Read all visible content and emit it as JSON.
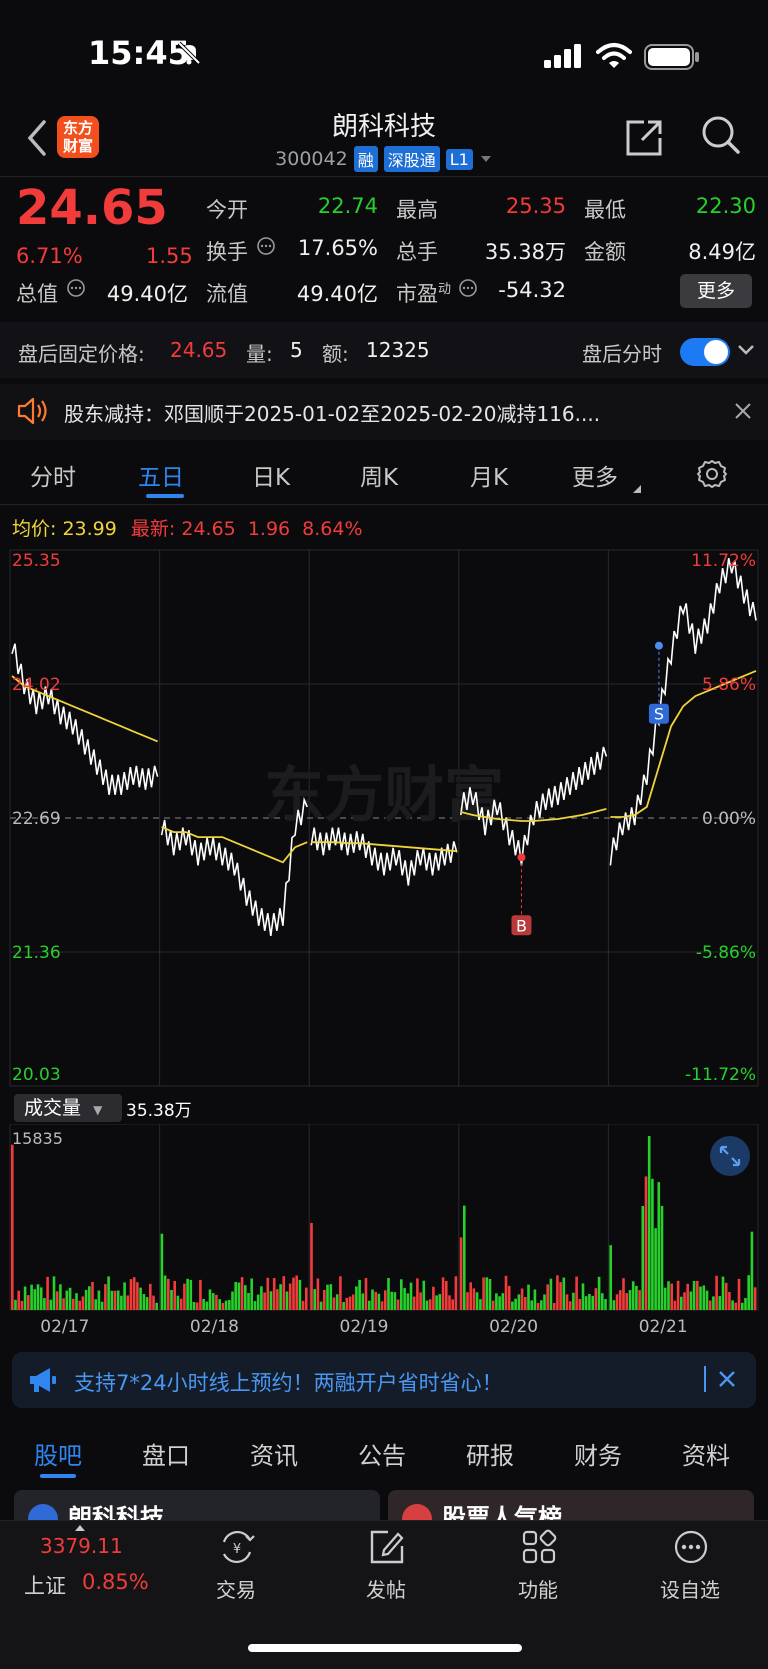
{
  "status": {
    "time": "15:45"
  },
  "header": {
    "back": "‹",
    "logo_line1": "东方",
    "logo_line2": "财富",
    "name": "朗科科技",
    "code": "300042",
    "tags": [
      "融",
      "深股通",
      "L1"
    ]
  },
  "quote": {
    "price": "24.65",
    "pct": "6.71%",
    "chg": "1.55",
    "open_label": "今开",
    "open": "22.74",
    "high_label": "最高",
    "high": "25.35",
    "low_label": "最低",
    "low": "22.30",
    "turnover_label": "换手",
    "turnover": "17.65%",
    "vol_label": "总手",
    "vol": "35.38万",
    "amount_label": "金额",
    "amount": "8.49亿",
    "mcap_label": "总值",
    "mcap": "49.40亿",
    "float_label": "流值",
    "float": "49.40亿",
    "pe_label": "市盈",
    "pe_sup": "动",
    "pe": "-54.32",
    "more": "更多"
  },
  "after_hours": {
    "label": "盘后固定价格:",
    "price": "24.65",
    "qty_label": "量:",
    "qty": "5",
    "amt_label": "额:",
    "amt": "12325",
    "toggle_label": "盘后分时"
  },
  "notice": {
    "text": "股东减持：邓国顺于2025-01-02至2025-02-20减持116...."
  },
  "period_tabs": [
    "分时",
    "五日",
    "日K",
    "周K",
    "月K",
    "更多"
  ],
  "chart_header": {
    "avg_label": "均价:",
    "avg": "23.99",
    "latest_label": "最新:",
    "latest": "24.65",
    "latest_chg": "1.96",
    "latest_pct": "8.64%"
  },
  "chart_data": {
    "type": "line",
    "title": "",
    "x": [
      "02/17",
      "02/18",
      "02/19",
      "02/20",
      "02/21"
    ],
    "ylim": [
      20.03,
      25.35
    ],
    "y_ticks_left": [
      "25.35",
      "24.02",
      "22.69",
      "21.36",
      "20.03"
    ],
    "y_ticks_right": [
      "11.72%",
      "5.86%",
      "0.00%",
      "-5.86%",
      "-11.72%"
    ],
    "prev_close": 22.69,
    "series": [
      {
        "name": "",
        "color": "#ffffff",
        "days": [
          [
            24.4,
            24.0,
            23.8,
            23.9,
            23.7,
            23.6,
            23.4,
            23.2,
            23.0,
            23.0,
            23.1,
            23.05,
            23.1
          ],
          [
            22.6,
            22.4,
            22.5,
            22.3,
            22.4,
            22.3,
            22.2,
            21.9,
            21.7,
            21.6,
            21.7,
            22.6,
            22.8
          ],
          [
            22.5,
            22.4,
            22.5,
            22.4,
            22.45,
            22.3,
            22.2,
            22.3,
            22.1,
            22.3,
            22.2,
            22.3,
            22.35
          ],
          [
            22.8,
            22.9,
            22.6,
            22.8,
            22.5,
            22.3,
            22.7,
            22.85,
            22.9,
            23.0,
            23.1,
            23.2,
            23.3
          ],
          [
            22.3,
            22.6,
            22.7,
            23.1,
            23.7,
            24.3,
            24.8,
            24.4,
            24.6,
            25.0,
            25.2,
            24.9,
            24.65
          ]
        ]
      },
      {
        "name": "",
        "color": "#f0d43c",
        "days": [
          [
            24.1,
            24.0,
            23.95,
            23.9,
            23.85,
            23.8,
            23.75,
            23.7,
            23.65,
            23.6,
            23.55,
            23.5,
            23.45
          ],
          [
            22.6,
            22.55,
            22.55,
            22.5,
            22.5,
            22.5,
            22.45,
            22.4,
            22.35,
            22.3,
            22.25,
            22.4,
            22.45
          ],
          [
            22.45,
            22.45,
            22.45,
            22.44,
            22.44,
            22.43,
            22.42,
            22.41,
            22.4,
            22.39,
            22.38,
            22.37,
            22.36
          ],
          [
            22.75,
            22.72,
            22.7,
            22.68,
            22.67,
            22.66,
            22.66,
            22.67,
            22.68,
            22.7,
            22.72,
            22.75,
            22.78
          ],
          [
            22.7,
            22.7,
            22.72,
            22.8,
            23.2,
            23.6,
            23.8,
            23.9,
            23.95,
            24.0,
            24.05,
            24.1,
            24.15
          ]
        ]
      }
    ],
    "markers": [
      {
        "label": "B",
        "day": 3,
        "index": 5,
        "value": 22.3
      },
      {
        "label": "S",
        "day": 4,
        "index": 4,
        "value": 24.4
      }
    ],
    "watermark": "东方财富"
  },
  "volume": {
    "label": "成交量",
    "value": "35.38万",
    "max_label": "15835"
  },
  "ad": {
    "text": "支持7*24小时线上预约！两融开户省时省心！"
  },
  "bottom_tabs": [
    "股吧",
    "盘口",
    "资讯",
    "公告",
    "研报",
    "财务",
    "资料"
  ],
  "cards": [
    "朗科科技",
    "股票人气榜"
  ],
  "bottom_nav": {
    "index_value": "3379.11",
    "index_name": "上证",
    "index_pct": "0.85%",
    "items": [
      "交易",
      "发帖",
      "功能",
      "设自选"
    ]
  },
  "colors": {
    "up": "#f23b3b",
    "down": "#27d12b",
    "accent": "#2f86f0",
    "avg": "#f0d43c"
  }
}
